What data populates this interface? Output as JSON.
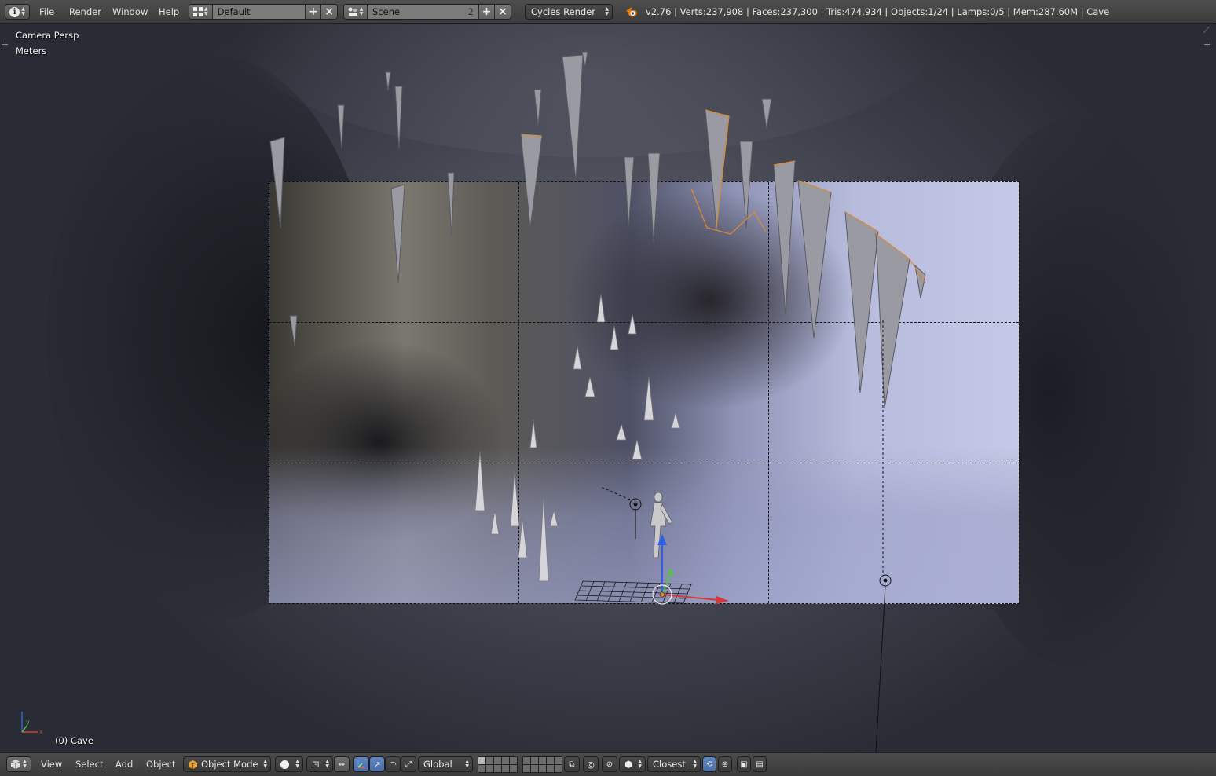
{
  "top_header": {
    "menus": [
      "File",
      "Render",
      "Window",
      "Help"
    ],
    "screen_layout": "Default",
    "scene": {
      "name": "Scene",
      "users": "2"
    },
    "render_engine": "Cycles Render",
    "stats": "v2.76 | Verts:237,908 | Faces:237,300 | Tris:474,934 | Objects:1/24 | Lamps:0/5 | Mem:287.60M | Cave"
  },
  "viewport": {
    "view_name": "Camera Persp",
    "units": "Meters",
    "object_label": "(0) Cave"
  },
  "bottom_header": {
    "menus": [
      "View",
      "Select",
      "Add",
      "Object"
    ],
    "mode": "Object Mode",
    "orientation": "Global",
    "snap_target": "Closest"
  },
  "colors": {
    "accent_blue": "#5680c2",
    "axis_x": "#d33a3a",
    "axis_y": "#52c24a",
    "axis_z": "#2f5fe0",
    "selection_outline": "#e28a2e"
  },
  "icons": {
    "editor_type": "info-icon",
    "layout": "screen-layout-icon",
    "scene": "scene-icon",
    "blender": "blender-logo-icon",
    "add": "plus-icon",
    "remove": "close-icon"
  }
}
